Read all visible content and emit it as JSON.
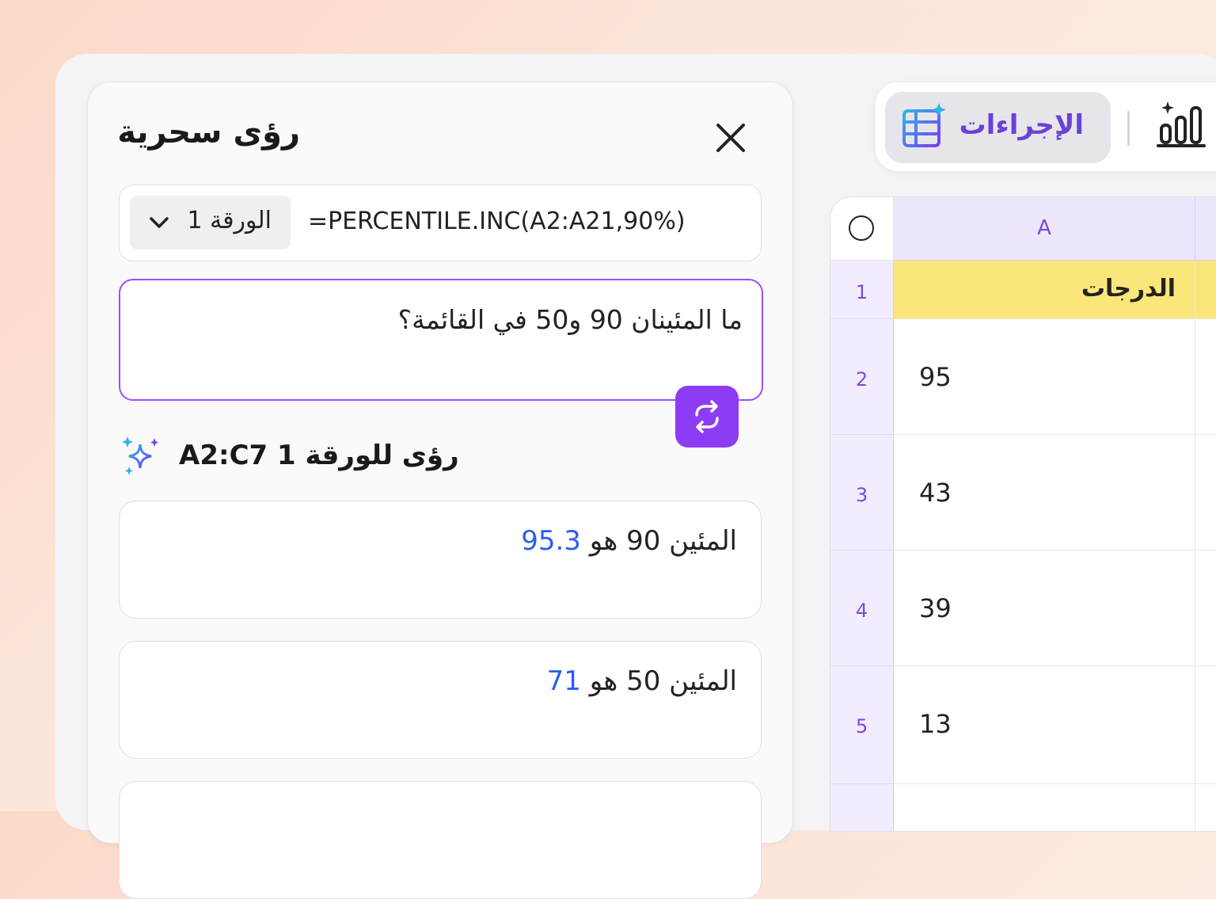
{
  "panel": {
    "title": "رؤى سحرية",
    "sheet_select": "الورقة 1",
    "formula": "=PERCENTILE.INC(A2:A21,90%)",
    "question": "ما المئينان 90 و50 في القائمة؟",
    "insights_title": "رؤى للورقة 1 A2:C7",
    "results": [
      {
        "label": "المئين 90 هو",
        "value": "95.3"
      },
      {
        "label": "المئين 50 هو",
        "value": "71"
      }
    ]
  },
  "toolbar": {
    "actions_label": "الإجراءات"
  },
  "sheet": {
    "column_a": "A",
    "header_cell": "الدرجات",
    "rows": [
      {
        "num": "1",
        "value": "الدرجات"
      },
      {
        "num": "2",
        "value": "95"
      },
      {
        "num": "3",
        "value": "43"
      },
      {
        "num": "4",
        "value": "39"
      },
      {
        "num": "5",
        "value": "13"
      }
    ]
  },
  "colors": {
    "accent": "#8d3cf5",
    "link_value": "#2a5cf0",
    "header_highlight": "#fbe67a"
  }
}
